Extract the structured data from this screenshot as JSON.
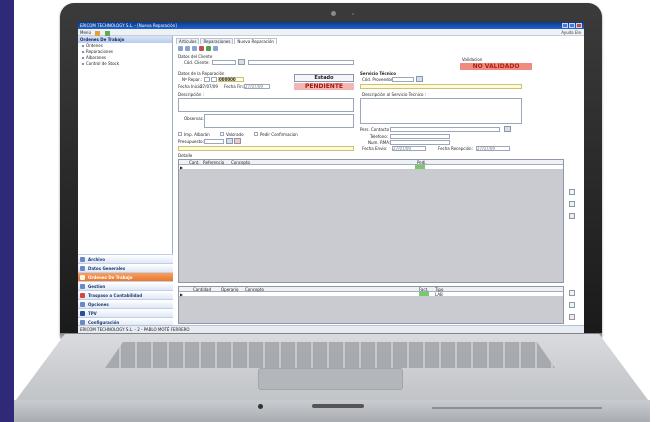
{
  "window": {
    "title": "ERICOM TECHNOLOGY S.L. - [Nueva Reparación]"
  },
  "menubar": {
    "item": "Menú",
    "right": "Ayuda Ele"
  },
  "leftpane": {
    "header": "Ordenes De Trabajo",
    "tree": [
      "Ordenes",
      "Reparaciones",
      "Albaranes",
      "Control de Stock"
    ],
    "nav": [
      "Archivo",
      "Datos Generales",
      "Ordenes De Trabajo",
      "Gestion",
      "Traspaso a Contabilidad",
      "Opciones",
      "TPV",
      "Configuración"
    ]
  },
  "status": {
    "text": "ERICOM TECHNOLOGY S.L. - 2 - PABLO MOTÉ FERRERO"
  },
  "tabs": [
    "Articulos",
    "Reparaciones",
    "Nueva Reparación"
  ],
  "form": {
    "datos_cliente": "Datos del Cliente",
    "cod_cliente_label": "Cód. Cliente:",
    "validacion_label": "Validacion",
    "validacion_value": "NO VALIDADO",
    "datos_reparacion": "Datos de la Reparación",
    "num_reparacion_label": "Nº Repar.:",
    "num_reparacion_value": "000000",
    "fecha_inicio_label": "Fecha Inicio:",
    "fecha_inicio_value": "27/07/09",
    "fecha_fin_label": "Fecha Fin:",
    "fecha_fin_value": "27/07/09",
    "estado_label": "Estado",
    "estado_value": "PENDIENTE",
    "descripcion_label": "Descripción :",
    "observac_label": "Observac.:",
    "imp_albaran": "Imp. Albarán",
    "valorado": "Valorado",
    "pedir_confirmacion": "Pedir Confirmacion",
    "presupuesto_label": "Presupuesto:",
    "servicio_tecnico": "Servicio Técnico",
    "cod_proveedor_label": "Cód. Proveedor:",
    "desc_servicio_label": "Descripción al Servicio Tecnico :",
    "pers_contacto_label": "Pers. Contacto :",
    "telefono_label": "Telefono:",
    "num_rma_label": "Num. RMA:",
    "fecha_envio_label": "Fecha Envio:",
    "fecha_envio_value": "27/07/09",
    "fecha_recepcion_label": "Fecha Recepción:",
    "fecha_recepcion_value": "27/07/09"
  },
  "grid1": {
    "title": "Detalle",
    "columns": [
      "Cant.",
      "Referencia",
      "Concepto",
      "Pedi."
    ]
  },
  "grid2": {
    "columns": [
      "Cantidad",
      "Operario",
      "Concepto",
      "Fact.",
      "Tipo"
    ],
    "row_tipo": "LAB"
  },
  "colors": {
    "accent": "#e9772d",
    "titlebar": "#0b3a8c",
    "pendiente": "#f3b7b3",
    "no_validado": "#ef8c80"
  }
}
